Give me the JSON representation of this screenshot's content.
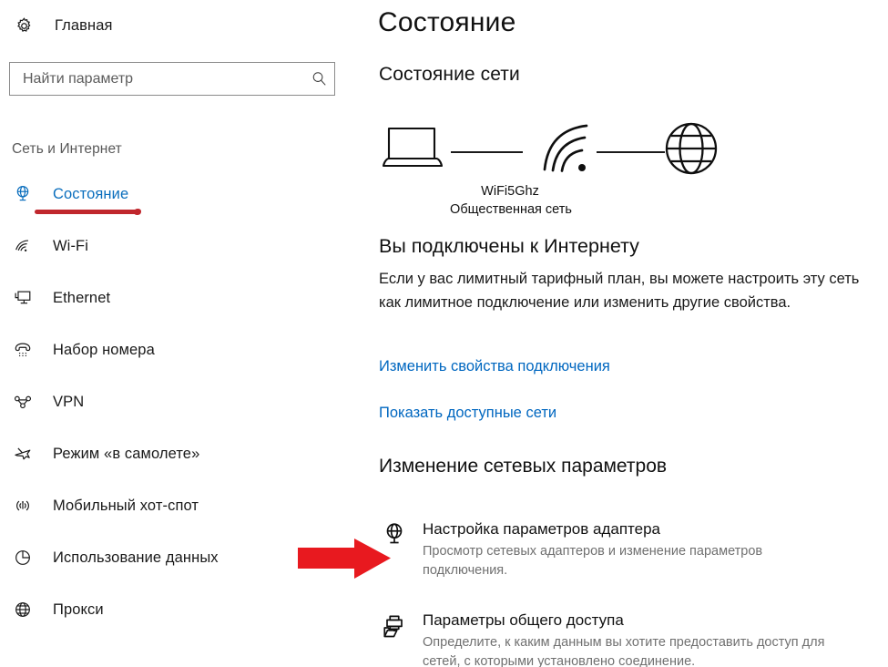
{
  "sidebar": {
    "home": {
      "label": "Главная",
      "icon": "gear-icon"
    },
    "search": {
      "placeholder": "Найти параметр",
      "value": "",
      "icon": "search-icon"
    },
    "category": "Сеть и Интернет",
    "items": [
      {
        "label": "Состояние",
        "icon": "globe-monitor-icon",
        "active": true
      },
      {
        "label": "Wi-Fi",
        "icon": "wifi-icon",
        "active": false
      },
      {
        "label": "Ethernet",
        "icon": "ethernet-icon",
        "active": false
      },
      {
        "label": "Набор номера",
        "icon": "dialup-phone-icon",
        "active": false
      },
      {
        "label": "VPN",
        "icon": "vpn-icon",
        "active": false
      },
      {
        "label": "Режим «в самолете»",
        "icon": "airplane-icon",
        "active": false
      },
      {
        "label": "Мобильный хот-спот",
        "icon": "hotspot-icon",
        "active": false
      },
      {
        "label": "Использование данных",
        "icon": "pie-chart-icon",
        "active": false
      },
      {
        "label": "Прокси",
        "icon": "globe-icon",
        "active": false
      }
    ]
  },
  "main": {
    "page_title": "Состояние",
    "section_title": "Состояние сети",
    "diagram": {
      "device_icon": "laptop-icon",
      "connection_icon": "wifi-icon",
      "internet_icon": "globe-icon",
      "ssid": "WiFi5Ghz",
      "network_type": "Общественная сеть"
    },
    "connected": {
      "heading": "Вы подключены к Интернету",
      "description": "Если у вас лимитный тарифный план, вы можете настроить эту сеть как лимитное подключение или изменить другие свойства."
    },
    "links": [
      {
        "label": "Изменить свойства подключения"
      },
      {
        "label": "Показать доступные сети"
      }
    ],
    "change_settings": {
      "title": "Изменение сетевых параметров",
      "items": [
        {
          "title": "Настройка параметров адаптера",
          "description": "Просмотр сетевых адаптеров и изменение параметров подключения.",
          "icon": "adapter-globe-monitor-icon"
        },
        {
          "title": "Параметры общего доступа",
          "description": "Определите, к каким данным вы хотите предоставить доступ для сетей, с которыми установлено соединение.",
          "icon": "printer-folder-icon"
        }
      ]
    }
  },
  "annotation": {
    "arrow": {
      "icon": "red-arrow-right-icon",
      "color": "#e8191f",
      "points_at": "Настройка параметров адаптера"
    },
    "underline": {
      "color": "#c0272d",
      "under": "Состояние"
    }
  },
  "colors": {
    "accent_link": "#0067c0",
    "active_nav": "#0a6ebd",
    "annotation_red": "#e8191f",
    "underline_red": "#c0272d",
    "text_primary": "#111111",
    "text_secondary": "#707070",
    "background": "#ffffff"
  }
}
